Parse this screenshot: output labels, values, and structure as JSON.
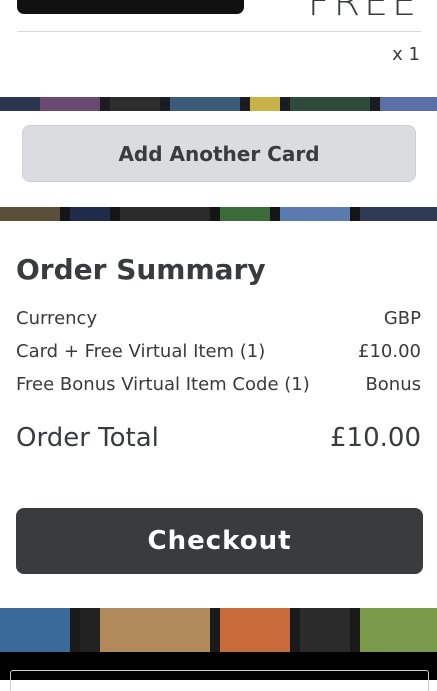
{
  "top_card": {
    "price_text": "FREE",
    "quantity": "x 1"
  },
  "add_card": {
    "label": "Add Another Card"
  },
  "summary": {
    "title": "Order Summary",
    "rows": [
      {
        "label": "Currency",
        "value": "GBP"
      },
      {
        "label": "Card + Free Virtual Item (1)",
        "value": "£10.00"
      },
      {
        "label": "Free Bonus Virtual Item Code (1)",
        "value": "Bonus"
      }
    ],
    "total_label": "Order Total",
    "total_value": "£10.00"
  },
  "checkout": {
    "label": "Checkout"
  },
  "colors": {
    "text": "#393b3d",
    "button_dark": "#393b3d",
    "button_light": "#dadcdf"
  }
}
